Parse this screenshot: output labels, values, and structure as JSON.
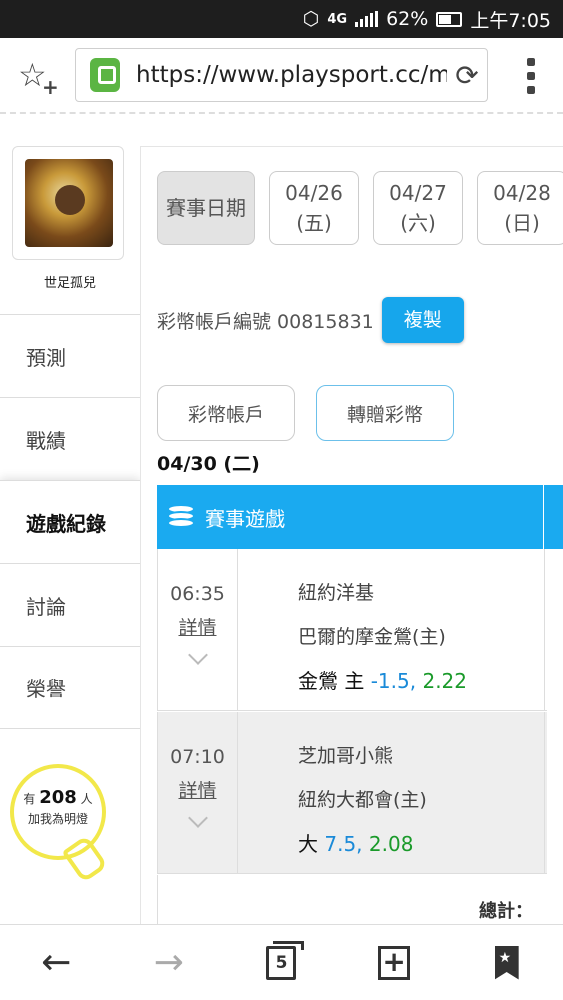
{
  "status_bar": {
    "network": "4G",
    "battery": "62%",
    "time": "上午7:05"
  },
  "browser": {
    "url": "https://www.playsport.cc/m",
    "icons": [
      "star-add-icon",
      "lock-icon",
      "reload-icon",
      "overflow-menu-icon"
    ]
  },
  "sidebar": {
    "username": "世足孤兒",
    "items": [
      {
        "label": "預測",
        "active": false
      },
      {
        "label": "戰績",
        "active": false
      },
      {
        "label": "遊戲紀錄",
        "active": true
      },
      {
        "label": "討論",
        "active": false
      },
      {
        "label": "榮譽",
        "active": false
      }
    ],
    "bulb": {
      "prefix": "有",
      "count": "208",
      "suffix": "人",
      "line2": "加我為明燈"
    }
  },
  "main": {
    "date_label": "賽事日期",
    "dates": [
      {
        "date": "04/26",
        "weekday": "(五)"
      },
      {
        "date": "04/27",
        "weekday": "(六)"
      },
      {
        "date": "04/28",
        "weekday": "(日)"
      }
    ],
    "account_label": "彩幣帳戶編號 00815831",
    "copy_button": "複製",
    "pill_account": "彩幣帳戶",
    "pill_transfer": "轉贈彩幣",
    "day_heading": "04/30 (二)",
    "table_title": "賽事遊戲",
    "games": [
      {
        "time": "06:35",
        "detail": "詳情",
        "away": "紐約洋基",
        "home": "巴爾的摩金鶯(主)",
        "pick_label": "金鶯 主",
        "pick_line": "-1.5",
        "pick_odds": "2.22"
      },
      {
        "time": "07:10",
        "detail": "詳情",
        "away": "芝加哥小熊",
        "home": "紐約大都會(主)",
        "pick_label": "大",
        "pick_line": "7.5",
        "pick_odds": "2.08"
      }
    ],
    "total_label": "總計："
  },
  "bottom_bar": {
    "tab_count": "5",
    "icons": [
      "back-arrow-icon",
      "forward-arrow-icon",
      "tabs-icon",
      "new-tab-icon",
      "bookmark-icon"
    ]
  },
  "colors": {
    "accent": "#1aaaf0",
    "copy_button": "#16a6ec",
    "line_blue": "#1a8ad8",
    "odds_green": "#1a9a2a",
    "bulb_yellow": "#f2e84a"
  }
}
